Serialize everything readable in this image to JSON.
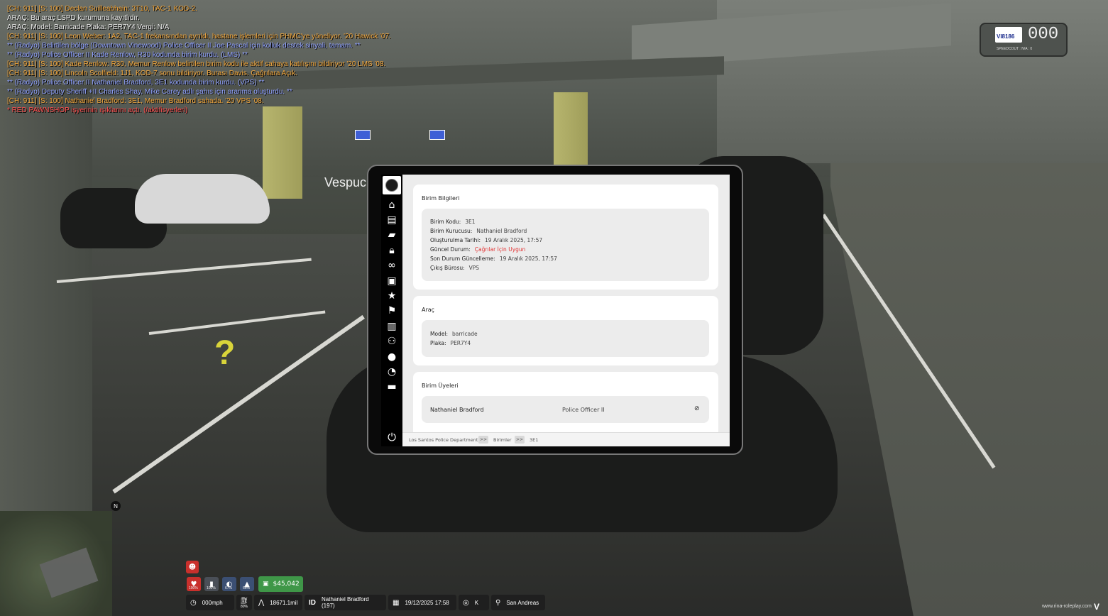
{
  "chat": [
    {
      "text": "[CH: 911] [S: 100] Declan Suilleabhain: 3T10, TAC-1 KOD-2.",
      "kind": "911"
    },
    {
      "text": "ARAÇ: Bu araç LSPD kurumuna kayıtlıdır.",
      "kind": "white"
    },
    {
      "text": "ARAÇ: Model: Barricade Plaka: PER7Y4 Vergi: N/A",
      "kind": "white"
    },
    {
      "text": "[CH: 911] [S: 100] Leon Weber: 1A2, TAC-1 frekansından ayrıldı, hastane işlemleri için PHMC'ye yöneliyor. '20 Hawick '07.",
      "kind": "911"
    },
    {
      "text": "** (Radyo) Belirtilen bölge (Downtown Vinewood) Police Officer II Joe Pascal için kolluk destek sinyali, tamam. **",
      "kind": "radio"
    },
    {
      "text": "** (Radyo) Police Officer II Kade Renlow, R30 kodunda birim kurdu. (LMS) **",
      "kind": "radio"
    },
    {
      "text": "[CH: 911] [S: 100] Kade Renlow: R30, Memur Renlow belirtilen birim kodu ile aktif sahaya katılışını bildiriyor '20 LMS '08.",
      "kind": "911"
    },
    {
      "text": "[CH: 911] [S: 100] Lincoln Scolfield: 1J1, KOD-7 sonu bildiriyor. Burası Davis. Çağrılara Açık.",
      "kind": "911"
    },
    {
      "text": "** (Radyo) Police Officer II Nathaniel Bradford, 3E1 kodunda birim kurdu. (VPS) **",
      "kind": "radio"
    },
    {
      "text": "** (Radyo) Deputy Sheriff +II Charles Shay, Mike Carey adlı şahıs için aranma oluşturdu. **",
      "kind": "radio"
    },
    {
      "text": "[CH: 911] [S: 100] Nathaniel Bradford: 3E1, Memur Bradford sahada. '20 VPS '08.",
      "kind": "911"
    },
    {
      "text": "* RED PAWNSHOP işyerinin ışıklarını açtı. (/aktifisyerleri)",
      "kind": "red"
    }
  ],
  "scene": {
    "street_label": "Vespuc",
    "marker": "?"
  },
  "vehicle_hud": {
    "plate": "VI8186",
    "speed": "000",
    "sub": "SPEEDCOUT : N/A : 0"
  },
  "tablet": {
    "unit_info": {
      "title": "Birim Bilgileri",
      "rows": [
        {
          "label": "Birim Kodu:",
          "value": "3E1"
        },
        {
          "label": "Birim Kurucusu:",
          "value": "Nathaniel Bradford"
        },
        {
          "label": "Oluşturulma Tarihi:",
          "value": "19 Aralık 2025, 17:57"
        },
        {
          "label": "Güncel Durum:",
          "value": "Çağrılar İçin Uygun"
        },
        {
          "label": "Son Durum Güncelleme:",
          "value": "19 Aralık 2025, 17:57"
        },
        {
          "label": "Çıkış Bürosu:",
          "value": "VPS"
        }
      ]
    },
    "vehicle": {
      "title": "Araç",
      "rows": [
        {
          "label": "Model:",
          "value": "barricade"
        },
        {
          "label": "Plaka:",
          "value": "PER7Y4"
        }
      ]
    },
    "members": {
      "title": "Birim Üyeleri",
      "items": [
        {
          "name": "Nathaniel Bradford",
          "rank": "Police Officer II"
        }
      ]
    },
    "breadcrumb": {
      "items": [
        "Los Santos Police Department",
        "Birimler",
        "3E1"
      ],
      "separator": ">>"
    },
    "status_color": "#e23131"
  },
  "hud": {
    "status": [
      {
        "icon": "heart-icon",
        "label": "100%",
        "color": "#c9302c"
      },
      {
        "icon": "food-icon",
        "label": "100%",
        "color": "#4a4f57"
      },
      {
        "icon": "drink-icon",
        "label": "67%",
        "color": "#3b4f73"
      },
      {
        "icon": "armor-icon",
        "label": "66%",
        "color": "#3b4f73"
      }
    ],
    "money": "$45,042",
    "speed": "000mph",
    "fuel": "80%",
    "mileage": "18671.1mil",
    "id_label": "ID",
    "player": "Nathaniel Bradford (197)",
    "datetime": "19/12/2025 17:58",
    "direction": "K",
    "location": "San Andreas",
    "brand": "www.rina-roleplay.com",
    "brand_mark": "V"
  }
}
